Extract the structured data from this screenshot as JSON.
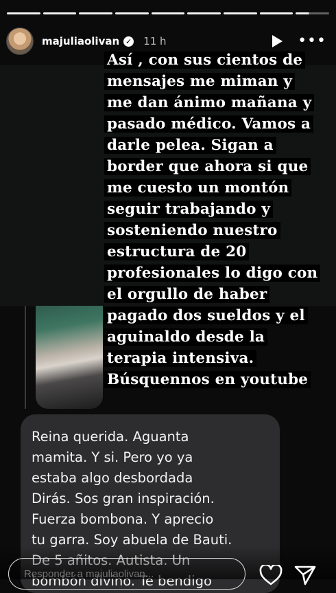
{
  "story": {
    "username": "majuliaolivan",
    "time": "11 h",
    "verified_mark": "✓",
    "more_glyph": "•••",
    "text_lines": [
      "Así , con sus cientos de",
      "mensajes me miman y",
      "me dan ánimo mañana y",
      "pasado médico. Vamos a",
      "darle pelea. Sigan a",
      "border que ahora si que",
      "me cuesto un montón",
      "seguir trabajando y",
      "sosteniendo nuestro",
      "estructura de 20",
      "profesionales lo digo con",
      "el orgullo de haber",
      "pagado dos sueldos y el",
      "aguinaldo desde la",
      "terapia intensiva.",
      "Búsquennos en youtube"
    ],
    "message": "Reina querida.  Aguanta\nmamita.  Y si.  Pero yo ya\nestaba algo desbordada\nDirás. Sos gran inspiración.\nFuerza bombona.   Y aprecio\ntu garra.  Soy abuela de Bauti.\nDe 5  añitos.   Autista.  Un\nbombón divino.  Te bendigo"
  },
  "reply": {
    "placeholder": "Responder a majuliaolivan..."
  },
  "icons": {
    "play": "play-icon",
    "more": "more-icon",
    "heart": "heart-icon",
    "send": "send-icon",
    "verified": "verified-badge-icon"
  }
}
